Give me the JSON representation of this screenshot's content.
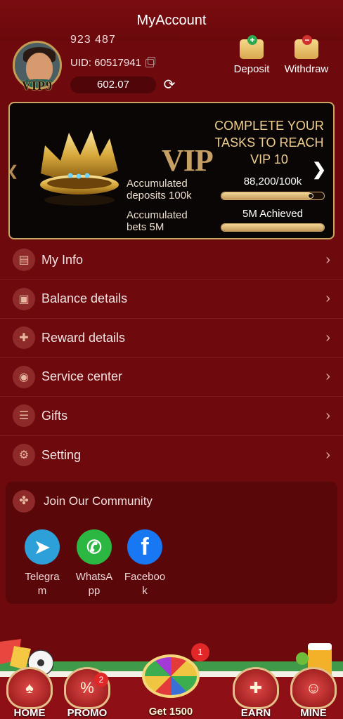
{
  "header": {
    "title": "MyAccount"
  },
  "profile": {
    "top_partial": "923   487",
    "vip_badge": "VIP9",
    "uid": "UID: 60517941",
    "balance": "602.07"
  },
  "actions": [
    {
      "label": "Deposit"
    },
    {
      "label": "Withdraw"
    }
  ],
  "vip_card": {
    "logo": "VIP",
    "task_title": "COMPLETE YOUR TASKS TO REACH VIP 10",
    "requirements": [
      {
        "label": "Accumulated deposits 100k",
        "value": "88,200/100k",
        "progress": 0.882
      },
      {
        "label": "Accumulated bets 5M",
        "value": "5M Achieved",
        "progress": 1.0
      }
    ]
  },
  "menu": [
    {
      "label": "My Info",
      "icon": "id-card-icon"
    },
    {
      "label": "Balance details",
      "icon": "wallet-icon"
    },
    {
      "label": "Reward details",
      "icon": "gift-box-icon"
    },
    {
      "label": "Service center",
      "icon": "headset-icon"
    },
    {
      "label": "Gifts",
      "icon": "ticket-icon"
    },
    {
      "label": "Setting",
      "icon": "gear-icon"
    }
  ],
  "community": {
    "title": "Join Our Community",
    "links": [
      {
        "label": "Telegram",
        "icon": "telegram-icon",
        "color": "#2ea0d9"
      },
      {
        "label": "WhatsApp",
        "icon": "whatsapp-icon",
        "color": "#2cb742"
      },
      {
        "label": "Facebook",
        "icon": "facebook-icon",
        "color": "#1877f2"
      }
    ]
  },
  "bottom_nav": {
    "home": "HOME",
    "promo": "PROMO",
    "promo_badge": "2",
    "wheel_label": "Get 1500",
    "wheel_badge": "1",
    "earn": "EARN",
    "mine": "MINE"
  },
  "colors": {
    "background": "#6e0a0d",
    "gold": "#c9a565",
    "accent_red": "#e12727"
  }
}
